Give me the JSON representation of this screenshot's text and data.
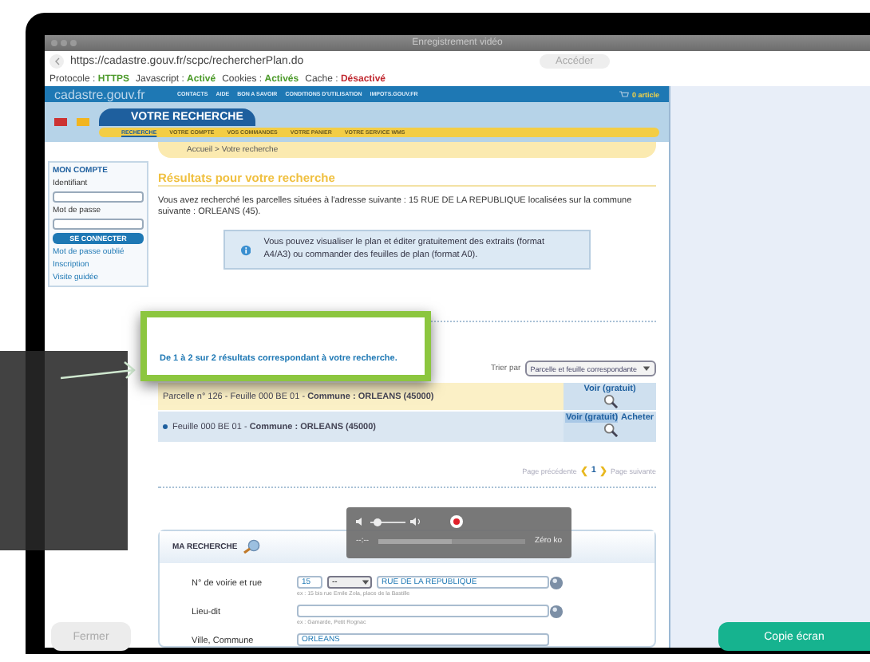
{
  "window": {
    "title": "Enregistrement vidéo"
  },
  "address_bar": {
    "url": "https://cadastre.gouv.fr/scpc/rechercherPlan.do",
    "button": "Accéder"
  },
  "status_line": [
    {
      "label": "Protocole :",
      "value": "HTTPS",
      "color": "#4c9a2a"
    },
    {
      "label": "Javascript :",
      "value": "Activé",
      "color": "#4c9a2a"
    },
    {
      "label": "Cookies :",
      "value": "Activés",
      "color": "#4c9a2a"
    },
    {
      "label": "Cache :",
      "value": "Désactivé",
      "color": "#c0282f"
    }
  ],
  "site": {
    "logo": "cadastre.gouv.fr",
    "nav": [
      "CONTACTS",
      "AIDE",
      "BON A SAVOIR",
      "CONDITIONS D'UTILISATION",
      "IMPOTS.GOUV.FR"
    ],
    "cart": "0 article",
    "banner_title": "VOTRE RECHERCHE",
    "tabs": [
      {
        "label": "RECHERCHE",
        "selected": true
      },
      {
        "label": "VOTRE COMPTE",
        "selected": false
      },
      {
        "label": "VOS COMMANDES",
        "selected": false
      },
      {
        "label": "VOTRE PANIER",
        "selected": false
      },
      {
        "label": "VOTRE SERVICE WMS",
        "selected": false
      }
    ],
    "breadcrumb": "Accueil > Votre recherche",
    "account": {
      "title": "MON COMPTE",
      "fields": [
        {
          "label": "Identifiant"
        },
        {
          "label": "Mot de passe"
        }
      ],
      "button": "SE CONNECTER",
      "links": [
        "Mot de passe oublié",
        "Inscription",
        "Visite guidée"
      ]
    },
    "results": {
      "heading": "Résultats pour votre recherche",
      "intro": "Vous avez recherché les parcelles situées à l'adresse suivante : 15 RUE DE LA REPUBLIQUE localisées sur la commune suivante : ORLEANS (45).",
      "info": "Vous pouvez visualiser le plan et éditer gratuitement des extraits (format A4/A3) ou commander des feuilles de plan (format A0).",
      "count": "De 1 à 2 sur 2 résultats correspondant à votre recherche.",
      "sort_label": "Trier par",
      "sort_value": "Parcelle et feuille correspondante",
      "rows": [
        {
          "kind": "parcel",
          "text": "Parcelle n° 126 - Feuille 000 BE 01 - **Commune : ORLEANS (45000)**",
          "actions": [
            {
              "label": "Voir (gratuit)",
              "selected": false
            }
          ]
        },
        {
          "kind": "sheet",
          "text": "Feuille 000 BE 01 - **Commune : ORLEANS (45000)**",
          "actions": [
            {
              "label": "Voir (gratuit)",
              "selected": true
            },
            {
              "label": "Acheter",
              "selected": false
            }
          ]
        }
      ],
      "pager": {
        "prev": "Page précédente",
        "left": "❮",
        "page": "1",
        "right": "❯",
        "next": "Page suivante"
      }
    },
    "search_form": {
      "title": "MA RECHERCHE",
      "rows": [
        {
          "label": "N° de voirie et rue",
          "fields": [
            {
              "kind": "number",
              "value": "15"
            },
            {
              "kind": "select",
              "value": "--"
            },
            {
              "kind": "street",
              "value": "RUE DE LA REPUBLIQUE"
            }
          ],
          "hint": "ex : 15 bis rue Emile Zola, place de la Bastille",
          "help": true
        },
        {
          "label": "Lieu-dit",
          "fields": [
            {
              "kind": "street"
            }
          ],
          "hint": "ex : Gamarde, Petit Rognac",
          "help": true
        },
        {
          "label": "Ville, Commune",
          "fields": [
            {
              "kind": "street",
              "value": "ORLEANS"
            }
          ],
          "help": false
        }
      ]
    }
  },
  "recorder": {
    "volume": {
      "level": 0.2
    },
    "progress": {
      "level": 0.5
    },
    "elapsed": "--:--",
    "size": "Zéro ko"
  },
  "buttons": {
    "close": "Fermer",
    "screenshot": "Copie écran"
  }
}
